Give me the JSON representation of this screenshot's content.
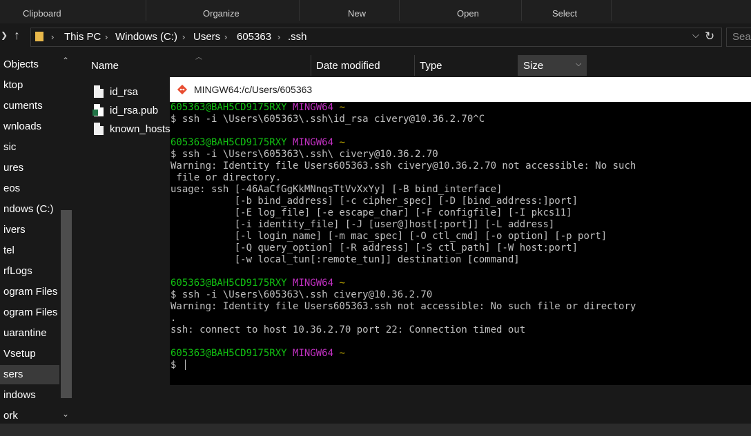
{
  "ribbon": {
    "groups": [
      "Clipboard",
      "Organize",
      "New",
      "Open",
      "Select"
    ]
  },
  "address": {
    "crumbs": [
      "This PC",
      "Windows (C:)",
      "Users",
      "605363",
      ".ssh"
    ],
    "search_placeholder": "Sea"
  },
  "nav": {
    "items": [
      "Objects",
      "ktop",
      "cuments",
      "wnloads",
      "sic",
      "ures",
      "eos",
      "ndows (C:)",
      "ivers",
      "tel",
      "rfLogs",
      "ogram Files",
      "ogram Files (",
      "uarantine",
      "Vsetup",
      "sers",
      "indows",
      "ork"
    ],
    "selected": "sers"
  },
  "filelist": {
    "columns": [
      "Name",
      "Date modified",
      "Type",
      "Size"
    ],
    "sorted_column": "Size",
    "files": [
      {
        "name": "id_rsa",
        "icon": "file-icon"
      },
      {
        "name": "id_rsa.pub",
        "icon": "publisher-file-icon"
      },
      {
        "name": "known_hosts",
        "icon": "file-icon"
      }
    ]
  },
  "terminal": {
    "title": "MINGW64:/c/Users/605363",
    "colors": {
      "user": "#12c212",
      "env": "#c030c0",
      "path": "#c8b000",
      "text": "#c0c0c0"
    },
    "prompt": {
      "user": "605363@BAH5CD9175RXY",
      "env": "MINGW64",
      "path": "~",
      "symbol": "$"
    },
    "lines": [
      {
        "type": "prompt"
      },
      {
        "type": "cmd",
        "text": "$ ssh -i \\Users\\605363\\.ssh\\id_rsa civery@10.36.2.70^C"
      },
      {
        "type": "blank"
      },
      {
        "type": "prompt"
      },
      {
        "type": "cmd",
        "text": "$ ssh -i \\Users\\605363\\.ssh\\ civery@10.36.2.70"
      },
      {
        "type": "out",
        "text": "Warning: Identity file Users605363.ssh civery@10.36.2.70 not accessible: No such"
      },
      {
        "type": "out",
        "text": " file or directory."
      },
      {
        "type": "out",
        "text": "usage: ssh [-46AaCfGgKkMNnqsTtVvXxYy] [-B bind_interface]"
      },
      {
        "type": "out",
        "text": "           [-b bind_address] [-c cipher_spec] [-D [bind_address:]port]"
      },
      {
        "type": "out",
        "text": "           [-E log_file] [-e escape_char] [-F configfile] [-I pkcs11]"
      },
      {
        "type": "out",
        "text": "           [-i identity_file] [-J [user@]host[:port]] [-L address]"
      },
      {
        "type": "out",
        "text": "           [-l login_name] [-m mac_spec] [-O ctl_cmd] [-o option] [-p port]"
      },
      {
        "type": "out",
        "text": "           [-Q query_option] [-R address] [-S ctl_path] [-W host:port]"
      },
      {
        "type": "out",
        "text": "           [-w local_tun[:remote_tun]] destination [command]"
      },
      {
        "type": "blank"
      },
      {
        "type": "prompt"
      },
      {
        "type": "cmd",
        "text": "$ ssh -i \\Users\\605363\\.ssh civery@10.36.2.70"
      },
      {
        "type": "out",
        "text": "Warning: Identity file Users605363.ssh not accessible: No such file or directory"
      },
      {
        "type": "out",
        "text": "."
      },
      {
        "type": "out",
        "text": "ssh: connect to host 10.36.2.70 port 22: Connection timed out"
      },
      {
        "type": "blank"
      },
      {
        "type": "prompt"
      },
      {
        "type": "input",
        "text": "$ "
      }
    ]
  }
}
